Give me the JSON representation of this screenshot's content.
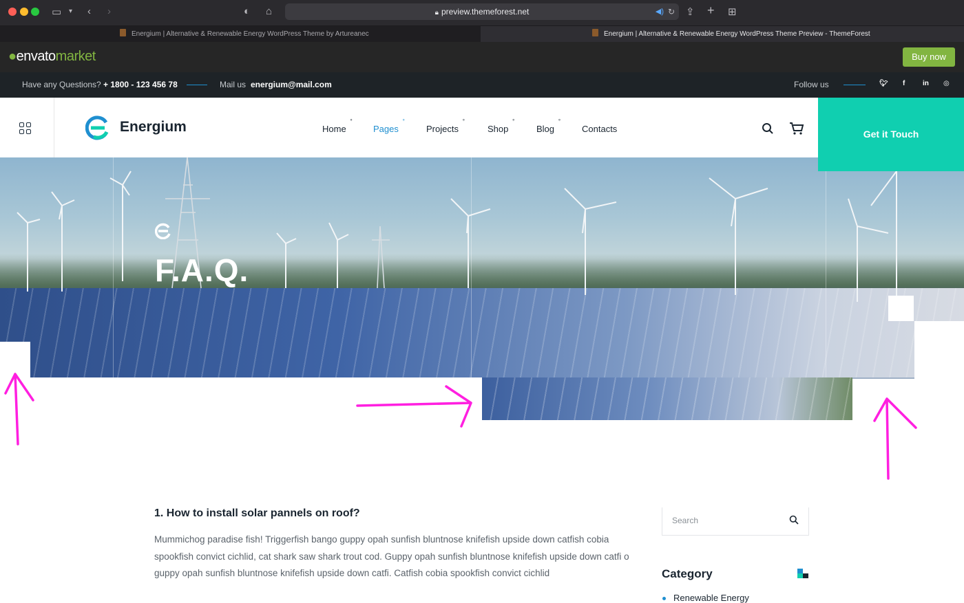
{
  "browser": {
    "url": "preview.themeforest.net",
    "tabs": [
      {
        "label": "Energium | Alternative & Renewable Energy WordPress Theme by Artureanec",
        "active": false
      },
      {
        "label": "Energium | Alternative & Renewable Energy WordPress Theme Preview - ThemeForest",
        "active": true
      }
    ]
  },
  "envato": {
    "logo_word": "envato",
    "logo_market": "market",
    "buy_label": "Buy now",
    "accent": "#82b541"
  },
  "topbar": {
    "question_label": "Have any Questions?",
    "phone": "+ 1800 - 123 456 78",
    "mail_label": "Mail us",
    "email": "energium@mail.com",
    "follow_label": "Follow us",
    "socials": [
      "twitter-icon",
      "facebook-icon",
      "linkedin-icon",
      "instagram-icon"
    ]
  },
  "header": {
    "brand": "Energium",
    "nav": [
      {
        "label": "Home",
        "active": false
      },
      {
        "label": "Pages",
        "active": true
      },
      {
        "label": "Projects",
        "active": false
      },
      {
        "label": "Shop",
        "active": false
      },
      {
        "label": "Blog",
        "active": false
      },
      {
        "label": "Contacts",
        "active": false
      }
    ],
    "cta_label": "Get it Touch",
    "cta_color": "#10cfb0",
    "active_color": "#1f8fd0"
  },
  "hero": {
    "title": "F.A.Q."
  },
  "faq": {
    "question": "1. How to install solar pannels on roof?",
    "answer": "Mummichog paradise fish! Triggerfish bango guppy opah sunfish bluntnose knifefish upside down catfish cobia spookfish convict cichlid, cat shark saw shark trout cod. Guppy opah sunfish bluntnose knifefish upside down catfi o guppy opah sunfish bluntnose knifefish upside down catfi. Catfish cobia spookfish convict cichlid"
  },
  "sidebar": {
    "search_placeholder": "Search",
    "category_title": "Category",
    "first_category": "Renewable Energy"
  },
  "annotation_color": "#ff1fe0"
}
